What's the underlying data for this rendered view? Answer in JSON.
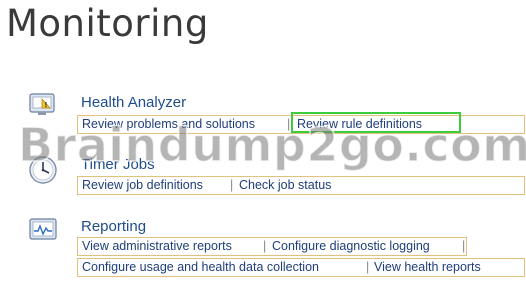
{
  "page": {
    "title": "Monitoring"
  },
  "health": {
    "heading": "Health Analyzer",
    "links": [
      "Review problems and solutions",
      "Review rule definitions"
    ]
  },
  "timer": {
    "heading": "Timer Jobs",
    "links": [
      "Review job definitions",
      "Check job status"
    ]
  },
  "reporting": {
    "heading": "Reporting",
    "row1": [
      "View administrative reports",
      "Configure diagnostic logging"
    ],
    "row2": [
      "Configure usage and health data collection",
      "View health reports"
    ]
  },
  "watermark": "Braindump2go.com",
  "colors": {
    "link": "#1f3e7a",
    "heading": "#1f4e8c",
    "row_border": "#e2c27a",
    "highlight": "#3dcc3d"
  },
  "icons": {
    "health": "health-analyzer-icon",
    "timer": "clock-icon",
    "reporting": "reporting-chart-icon"
  }
}
